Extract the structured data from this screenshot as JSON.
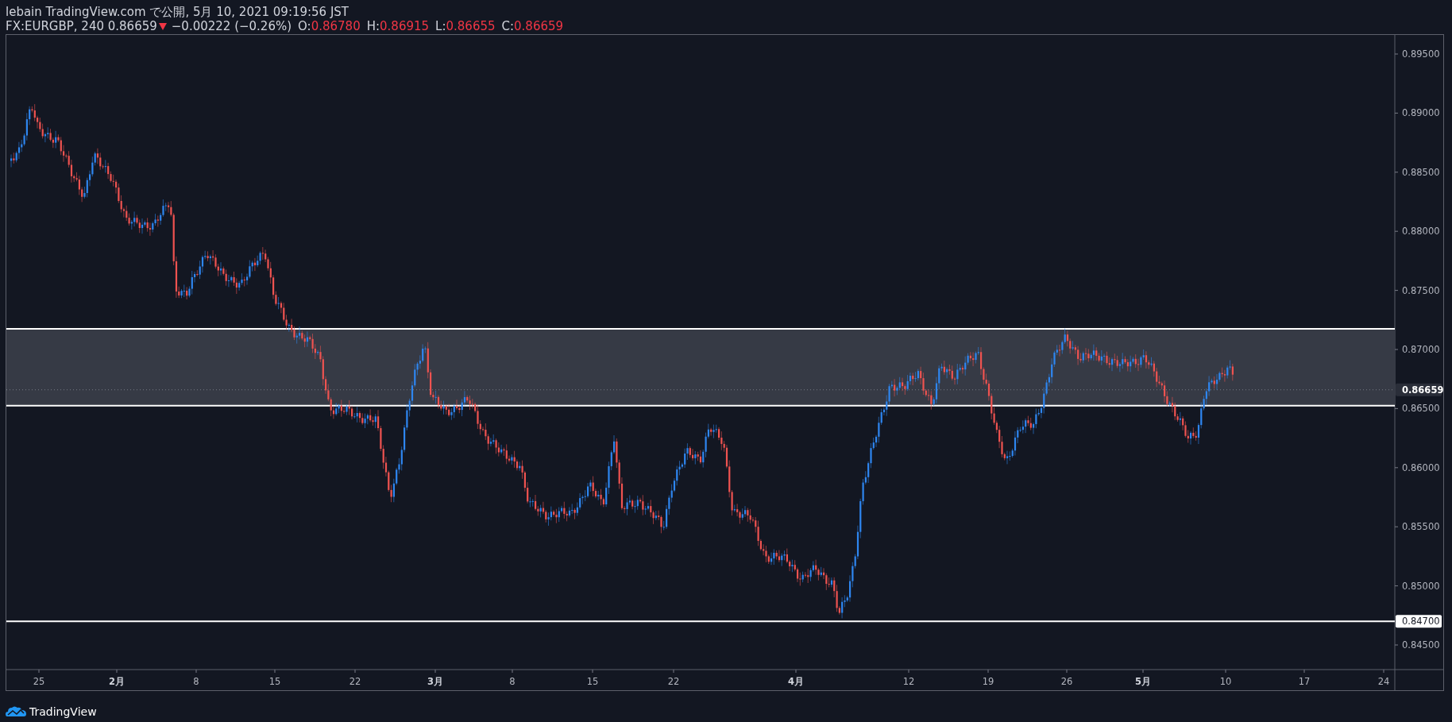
{
  "header": {
    "title": "lebain TradingView.com で公開, 5月 10, 2021 09:19:56 JST",
    "symbol": "FX:EURGBP, 240 0.86659",
    "falling": true,
    "change": "−0.00222 (−0.26%)",
    "ohlc": [
      {
        "label": "O:",
        "value": "0.86780"
      },
      {
        "label": "H:",
        "value": "0.86915"
      },
      {
        "label": "L:",
        "value": "0.86655"
      },
      {
        "label": "C:",
        "value": "0.86659"
      }
    ]
  },
  "chart": {
    "price_labels": [
      "0.89500",
      "0.89000",
      "0.88500",
      "0.88000",
      "0.87500",
      "0.87000",
      "0.86500",
      "0.86000",
      "0.85500",
      "0.85000",
      "0.84500"
    ],
    "current_price": "0.86659",
    "line_label": "0.84700",
    "date_labels": [
      {
        "text": "25",
        "kind": "day"
      },
      {
        "text": "2月",
        "kind": "month"
      },
      {
        "text": "8",
        "kind": "day"
      },
      {
        "text": "15",
        "kind": "day"
      },
      {
        "text": "22",
        "kind": "day"
      },
      {
        "text": "3月",
        "kind": "month"
      },
      {
        "text": "8",
        "kind": "day"
      },
      {
        "text": "15",
        "kind": "day"
      },
      {
        "text": "22",
        "kind": "day"
      },
      {
        "text": "4月",
        "kind": "month"
      },
      {
        "text": "12",
        "kind": "day"
      },
      {
        "text": "19",
        "kind": "day"
      },
      {
        "text": "26",
        "kind": "day"
      },
      {
        "text": "5月",
        "kind": "month"
      },
      {
        "text": "10",
        "kind": "day"
      },
      {
        "text": "17",
        "kind": "day"
      },
      {
        "text": "24",
        "kind": "day"
      }
    ]
  },
  "footer": {
    "brand": "TradingView"
  }
}
